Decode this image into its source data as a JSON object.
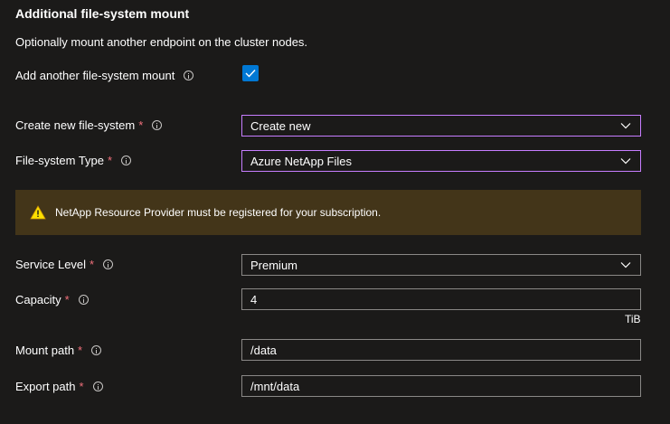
{
  "section": {
    "title": "Additional file-system mount",
    "description": "Optionally mount another endpoint on the cluster nodes."
  },
  "add_mount": {
    "label": "Add another file-system mount",
    "checked": true
  },
  "create_new_fs": {
    "label": "Create new file-system",
    "required_mark": "*",
    "value": "Create new"
  },
  "fs_type": {
    "label": "File-system Type",
    "required_mark": "*",
    "value": "Azure NetApp Files"
  },
  "warning": {
    "icon": "warning-icon",
    "message": "NetApp Resource Provider must be registered for your subscription."
  },
  "service_level": {
    "label": "Service Level",
    "required_mark": "*",
    "value": "Premium"
  },
  "capacity": {
    "label": "Capacity",
    "required_mark": "*",
    "value": "4",
    "unit": "TiB"
  },
  "mount_path": {
    "label": "Mount path",
    "required_mark": "*",
    "value": "/data"
  },
  "export_path": {
    "label": "Export path",
    "required_mark": "*",
    "value": "/mnt/data"
  },
  "colors": {
    "background": "#1b1a19",
    "accent": "#0078d4",
    "focus_border": "#c77dff",
    "required": "#f1707b",
    "warning_bg": "#433519",
    "warning_icon": "#fce100"
  }
}
